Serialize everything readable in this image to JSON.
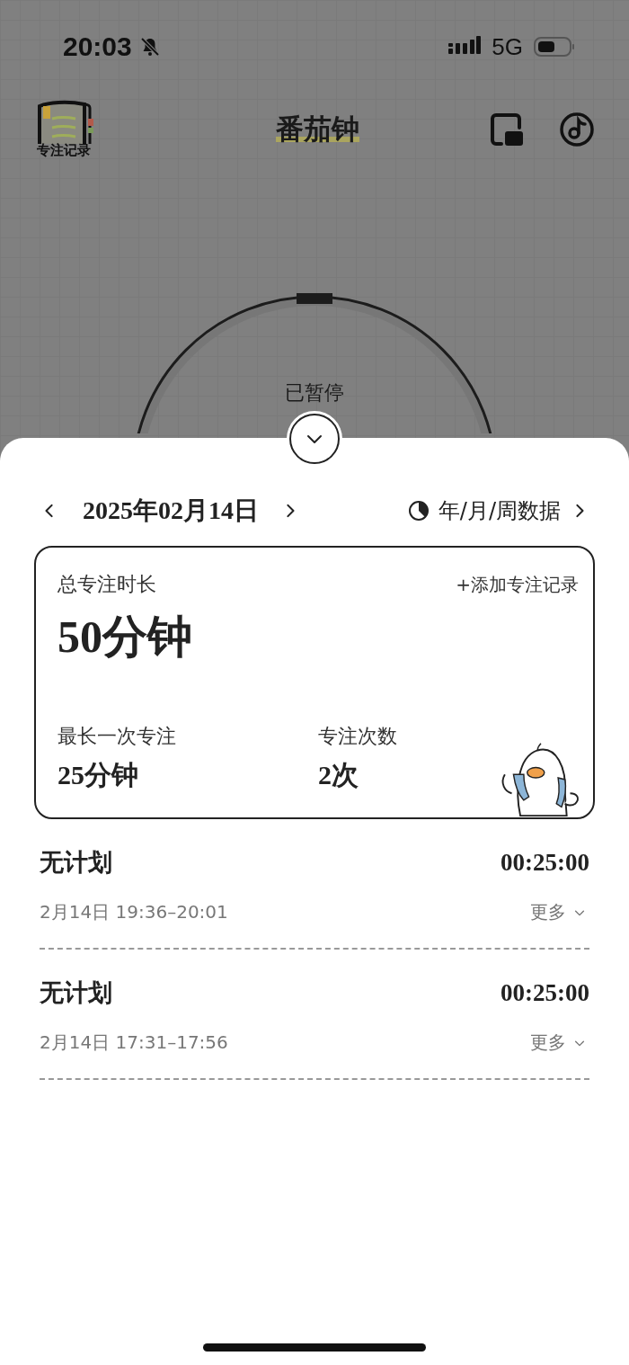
{
  "status_bar": {
    "time": "20:03",
    "silent": true,
    "network": "5G"
  },
  "header": {
    "records_label": "专注记录",
    "title": "番茄钟"
  },
  "timer": {
    "state_label": "已暂停"
  },
  "stats_nav": {
    "date": "2025年02月14日",
    "data_link": "年/月/周数据"
  },
  "summary": {
    "total_label": "总专注时长",
    "add_link": "+添加专注记录",
    "total_value": "50分钟",
    "longest_label": "最长一次专注",
    "longest_value": "25分钟",
    "count_label": "专注次数",
    "count_value": "2次"
  },
  "sessions": [
    {
      "title": "无计划",
      "duration": "00:25:00",
      "time_range": "2月14日 19:36–20:01",
      "more_label": "更多"
    },
    {
      "title": "无计划",
      "duration": "00:25:00",
      "time_range": "2月14日 17:31–17:56",
      "more_label": "更多"
    }
  ]
}
